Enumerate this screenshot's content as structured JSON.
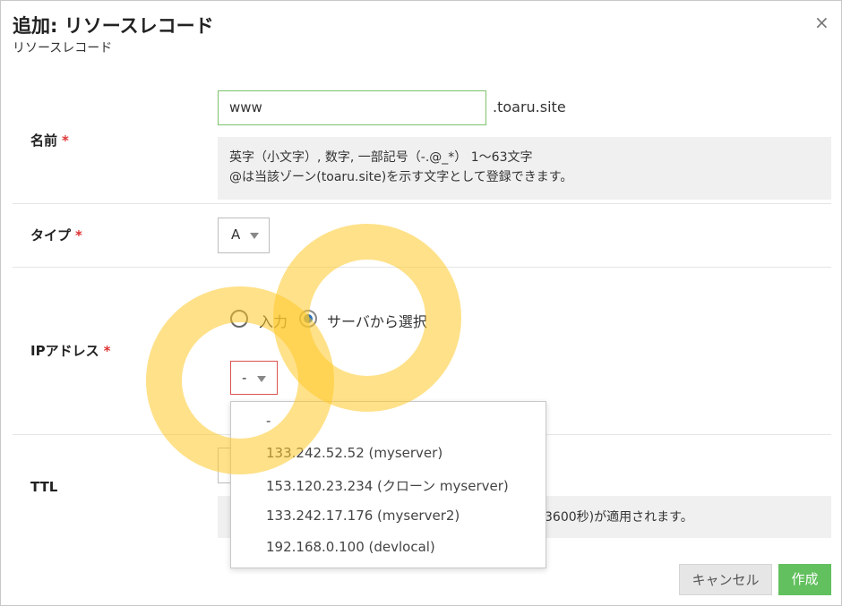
{
  "dialog": {
    "title": "追加: リソースレコード",
    "subtitle": "リソースレコード",
    "close_label": "×"
  },
  "name_field": {
    "label": "名前",
    "required_mark": "*",
    "value": "www",
    "suffix": ".toaru.site",
    "help_line1": "英字（小文字）, 数字, 一部記号（-.@_*） 1〜63文字",
    "help_line2": "@は当該ゾーン(toaru.site)を示す文字として登録できます。"
  },
  "type_field": {
    "label": "タイプ",
    "required_mark": "*",
    "selected": "A"
  },
  "ip_field": {
    "label": "IPアドレス",
    "required_mark": "*",
    "radio_input_label": "入力",
    "radio_server_label": "サーバから選択",
    "selected": "-",
    "options": [
      "-",
      "133.242.52.52 (myserver)",
      "153.120.23.234 (クローン myserver)",
      "133.242.17.176 (myserver2)",
      "192.168.0.100 (devlocal)"
    ]
  },
  "ttl_field": {
    "label": "TTL",
    "help_visible": "3600秒)が適用されます。"
  },
  "buttons": {
    "cancel": "キャンセル",
    "create": "作成"
  },
  "colors": {
    "accent_green": "#62c05e",
    "required_red": "#dd3333",
    "input_border_green": "#7cc36d",
    "error_border_red": "#d9534f",
    "radio_selected_blue": "#2b6fb7",
    "highlight_ring": "#ffc828"
  }
}
